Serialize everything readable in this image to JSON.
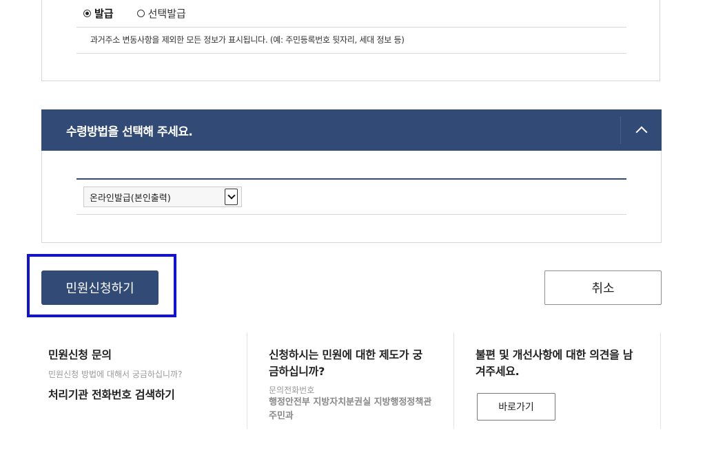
{
  "issue_options": {
    "selected": "발급",
    "items": [
      {
        "label": "발급",
        "checked": true
      },
      {
        "label": "선택발급",
        "checked": false
      }
    ],
    "note": "과거주소 변동사항을 제외한 모든 정보가 표시됩니다. (예: 주민등록번호 뒷자리, 세대 정보 등)"
  },
  "receive_method": {
    "title": "수령방법을 선택해 주세요.",
    "toggle_icon": "chevron-up-icon",
    "select_value": "온라인발급(본인출력)"
  },
  "actions": {
    "apply_label": "민원신청하기",
    "cancel_label": "취소"
  },
  "info": {
    "col1": {
      "title": "민원신청 문의",
      "sub": "민원신청 방법에 대해서 궁금하십니까?",
      "link": "처리기관 전화번호 검색하기"
    },
    "col2": {
      "title_line1": "신청하시는 민원에 대한 제도가 궁",
      "title_line2": "금하십니까?",
      "sub": "문의전화번호",
      "dept_line1": "행정안전부 지방자치분권실 지방행정정책관",
      "dept_line2": "주민과"
    },
    "col3": {
      "title_line1": "불편 및 개선사항에 대한 의견을 남",
      "title_line2": "겨주세요.",
      "button": "바로가기"
    }
  },
  "colors": {
    "primary": "#324b76",
    "highlight": "#1010e0",
    "border": "#d6d6d6"
  }
}
